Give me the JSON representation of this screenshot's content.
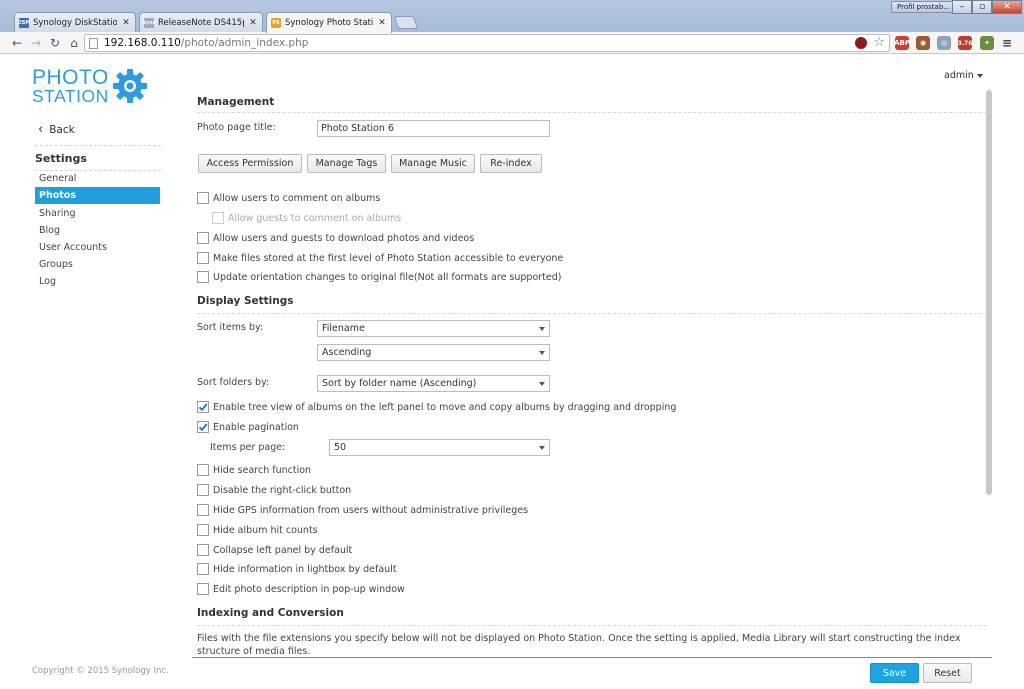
{
  "browser": {
    "tabs": [
      {
        "label": "Synology DiskStation - Sy",
        "favicon": "DSM",
        "active": false
      },
      {
        "label": "ReleaseNote DS415play -",
        "favicon": "Syno",
        "active": false
      },
      {
        "label": "Synology Photo Station 6",
        "favicon": "PS",
        "active": true
      }
    ],
    "profile": "Profil prostab...",
    "url_host": "192.168.0.110",
    "url_path": "/photo/admin_index.php",
    "ext_badge": "3.76"
  },
  "logo": {
    "line1": "PHOTO",
    "line2": "STATION",
    "color": "#2e9be0"
  },
  "nav": {
    "back": "Back",
    "settings_title": "Settings",
    "items": [
      "General",
      "Photos",
      "Sharing",
      "Blog",
      "User Accounts",
      "Groups",
      "Log"
    ],
    "active_item": "Photos"
  },
  "user": {
    "name": "admin"
  },
  "management": {
    "title": "Management",
    "page_title_label": "Photo page title:",
    "page_title_value": "Photo Station 6",
    "buttons": [
      "Access Permission",
      "Manage Tags",
      "Manage Music",
      "Re-index"
    ],
    "options": [
      {
        "label": "Allow users to comment on albums",
        "checked": false,
        "disabled": false
      },
      {
        "label": "Allow guests to comment on albums",
        "checked": false,
        "disabled": true
      },
      {
        "label": "Allow users and guests to download photos and videos",
        "checked": false,
        "disabled": false
      },
      {
        "label": "Make files stored at the first level of Photo Station accessible to everyone",
        "checked": false,
        "disabled": false
      },
      {
        "label": "Update orientation changes to original file(Not all formats are supported)",
        "checked": false,
        "disabled": false
      }
    ]
  },
  "display": {
    "title": "Display Settings",
    "sort_items_label": "Sort items by:",
    "sort_items_field": "Filename",
    "sort_items_order": "Ascending",
    "sort_folders_label": "Sort folders by:",
    "sort_folders_value": "Sort by folder name (Ascending)",
    "tree_view": {
      "label": "Enable tree view of albums on the left panel to move and copy albums by dragging and dropping",
      "checked": true
    },
    "pagination": {
      "label": "Enable pagination",
      "checked": true
    },
    "items_per_page_label": "Items per page:",
    "items_per_page_value": "50",
    "options": [
      {
        "label": "Hide search function",
        "checked": false
      },
      {
        "label": "Disable the right-click button",
        "checked": false
      },
      {
        "label": "Hide GPS information from users without administrative privileges",
        "checked": false
      },
      {
        "label": "Hide album hit counts",
        "checked": false
      },
      {
        "label": "Collapse left panel by default",
        "checked": false
      },
      {
        "label": "Hide information in lightbox by default",
        "checked": false
      },
      {
        "label": "Edit photo description in pop-up window",
        "checked": false
      }
    ]
  },
  "indexing": {
    "title": "Indexing and Conversion",
    "description": "Files with the file extensions you specify below will not be displayed on Photo Station. Once the setting is applied, Media Library will start constructing the index structure of media files."
  },
  "footer": {
    "copyright": "Copyright © 2015 Synology Inc.",
    "save": "Save",
    "reset": "Reset"
  },
  "colors": {
    "accent": "#1da3e4",
    "active_nav": "#1d9fe0"
  }
}
